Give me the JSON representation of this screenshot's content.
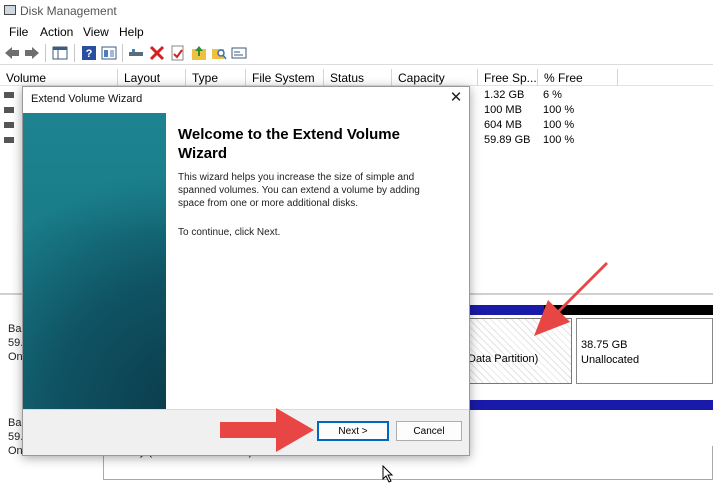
{
  "window": {
    "title": "Disk Management"
  },
  "menu": [
    "File",
    "Action",
    "View",
    "Help"
  ],
  "columns": [
    "Volume",
    "Layout",
    "Type",
    "File System",
    "Status",
    "Capacity",
    "Free Sp...",
    "% Free"
  ],
  "volumes": [
    {
      "free": "1.32 GB",
      "pct": "6 %"
    },
    {
      "free": "100 MB",
      "pct": "100 %"
    },
    {
      "free": "604 MB",
      "pct": "100 %"
    },
    {
      "free": "59.89 GB",
      "pct": "100 %"
    }
  ],
  "disks": {
    "disk0": {
      "line1": "Ba",
      "line2": "59.",
      "line3": "On"
    },
    "disk1": {
      "line1": "Ba",
      "line2": "59.",
      "line3": "Online"
    }
  },
  "partitions": {
    "data_partition": "Data Partition)",
    "unallocated_size": "38.75 GB",
    "unallocated_label": "Unallocated",
    "healthy": "Healthy (Basic Data Partition)"
  },
  "wizard": {
    "title": "Extend Volume Wizard",
    "heading": "Welcome to the Extend Volume Wizard",
    "description": "This wizard helps you increase the size of simple and spanned volumes. You can extend a volume  by adding space from one or more additional disks.",
    "continue_text": "To continue, click Next.",
    "next_label": "Next >",
    "cancel_label": "Cancel"
  },
  "colors": {
    "bar_blue": "#1a1aa8",
    "banner_teal": "#0f5364",
    "arrow_red": "#e84545",
    "accent": "#0067c0"
  },
  "icons": [
    "back-arrow-icon",
    "forward-arrow-icon",
    "grid-icon",
    "help-icon",
    "properties-icon",
    "connect-icon",
    "delete-icon",
    "check-icon",
    "folder-up-icon",
    "search-folder-icon",
    "console-icon",
    "close-icon",
    "mouse-cursor-icon"
  ]
}
